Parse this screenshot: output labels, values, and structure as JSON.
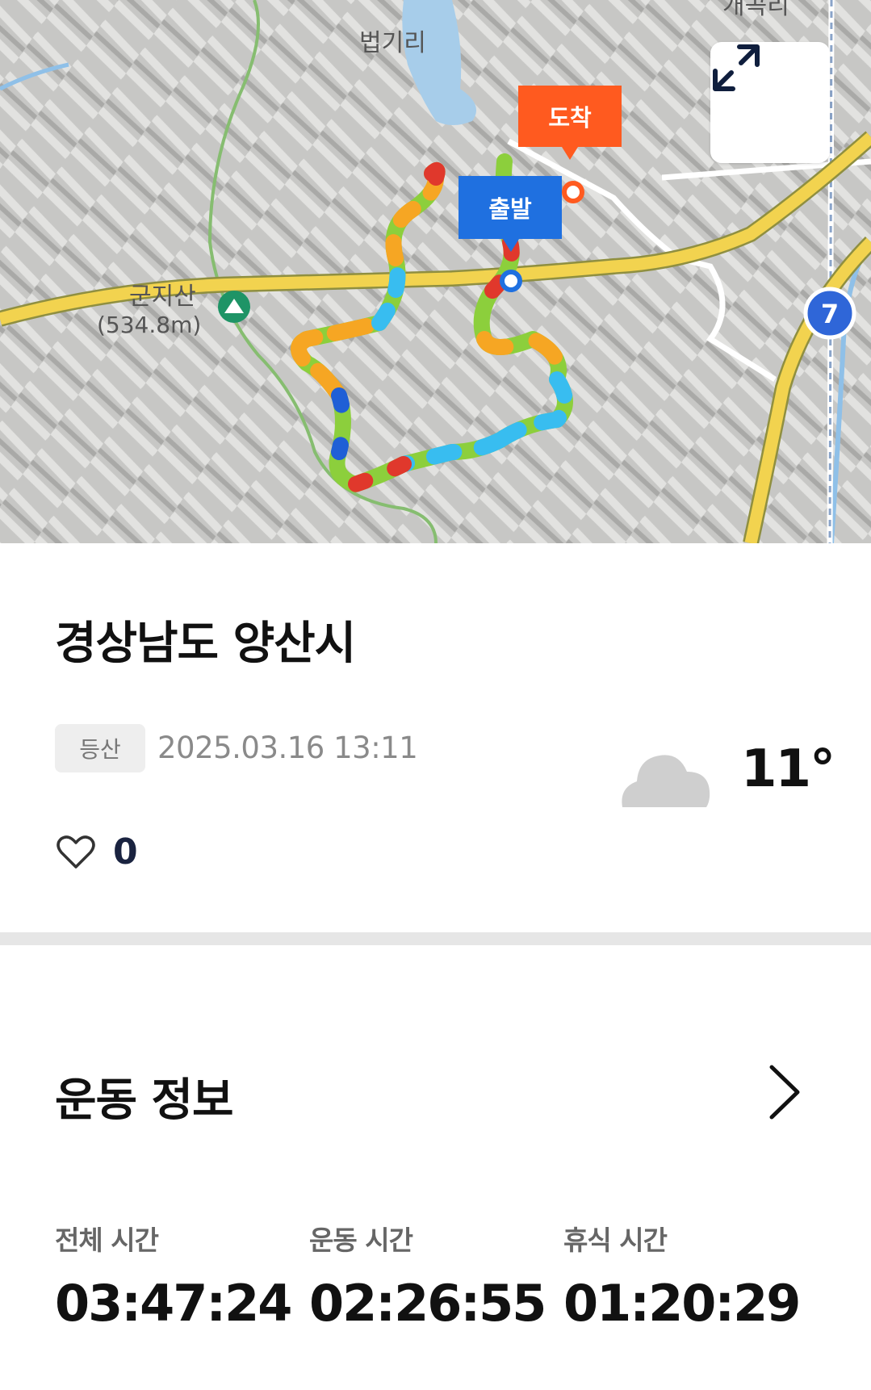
{
  "map": {
    "place_labels": {
      "village_top": "법기리",
      "mountain_name": "군지산",
      "mountain_height": "(534.8m)",
      "corner_top": "개곡리",
      "route_number": "7"
    },
    "markers": {
      "arrive": "도착",
      "start": "출발"
    },
    "expand_icon": "expand-arrows-icon"
  },
  "activity": {
    "title": "경상남도 양산시",
    "category": "등산",
    "datetime": "2025.03.16 13:11",
    "weather_icon": "cloud-icon",
    "temperature": "11°",
    "likes": "0"
  },
  "exercise_info": {
    "heading": "운동 정보",
    "chevron_icon": "chevron-right-icon",
    "stats": [
      {
        "label": "전체 시간",
        "value": "03:47:24"
      },
      {
        "label": "운동 시간",
        "value": "02:26:55"
      },
      {
        "label": "휴식 시간",
        "value": "01:20:29"
      }
    ]
  },
  "colors": {
    "arrive_marker": "#ff5a1f",
    "start_marker": "#1f70e0",
    "road": "#f2d34f",
    "route_green": "#8ccf3c",
    "route_orange": "#f6a623",
    "route_sky": "#38bdf0",
    "route_red": "#e0382c",
    "route_blue": "#1f5fd6"
  }
}
